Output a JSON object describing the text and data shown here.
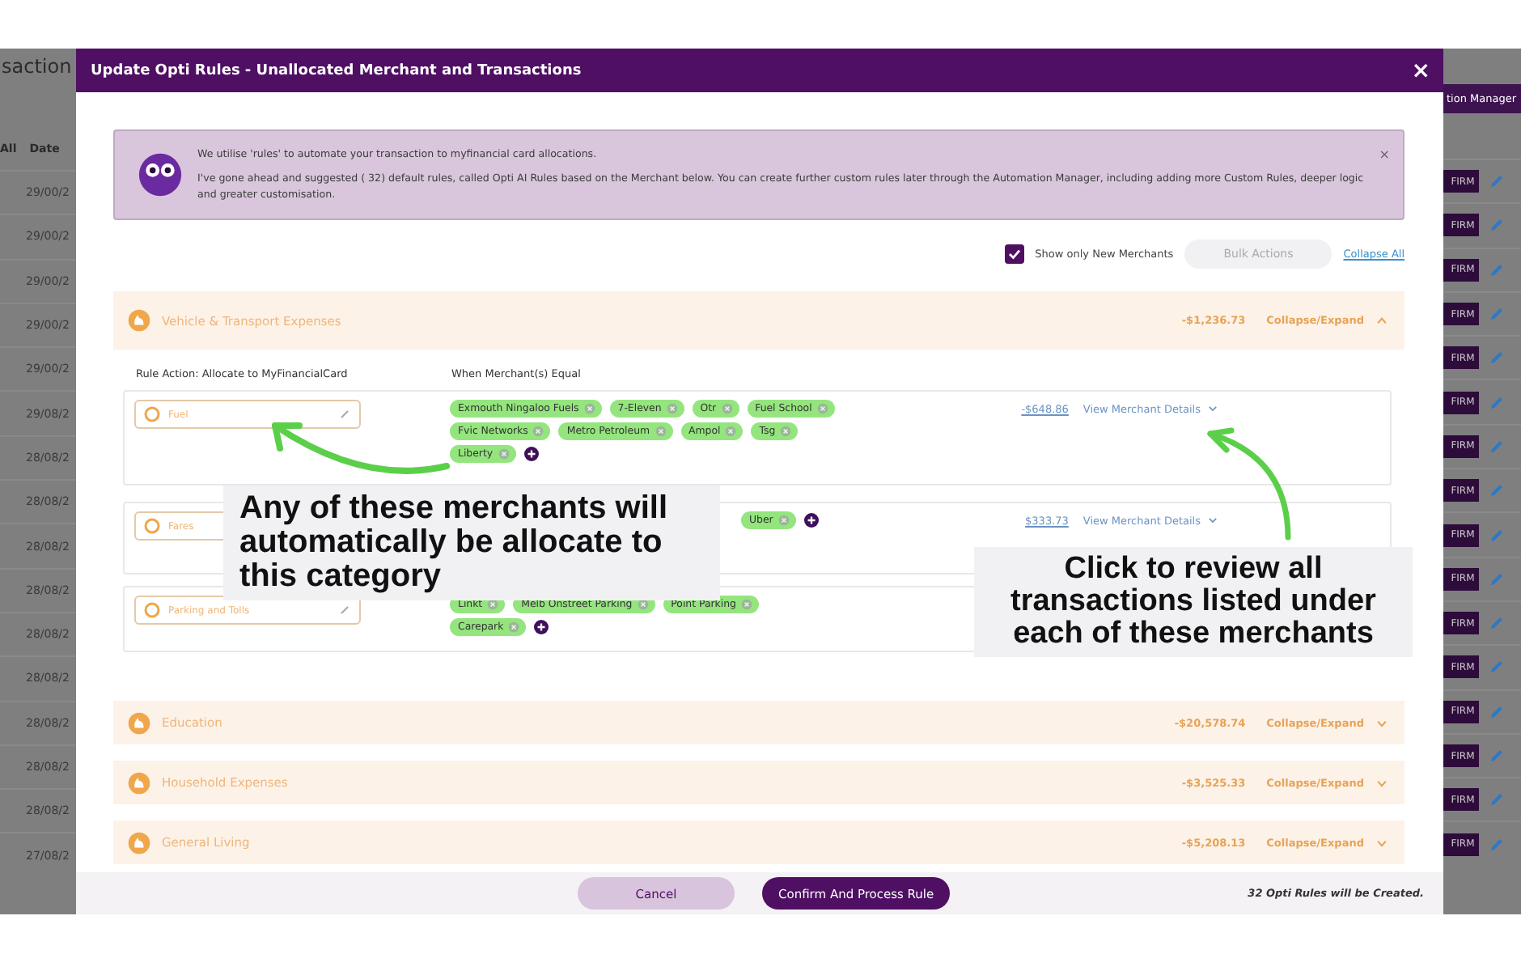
{
  "background": {
    "page_title": "saction",
    "header_all": "All",
    "header_date": "Date",
    "automation_button": "tion Manager",
    "rows": [
      {
        "date": "29/00/2",
        "action": "FIRM"
      },
      {
        "date": "29/00/2",
        "action": "FIRM"
      },
      {
        "date": "29/00/2",
        "action": "FIRM"
      },
      {
        "date": "29/00/2",
        "action": "FIRM"
      },
      {
        "date": "29/00/2",
        "action": "FIRM"
      },
      {
        "date": "29/08/2",
        "action": "FIRM"
      },
      {
        "date": "28/08/2",
        "action": "FIRM"
      },
      {
        "date": "28/08/2",
        "action": "FIRM"
      },
      {
        "date": "28/08/2",
        "action": "FIRM"
      },
      {
        "date": "28/08/2",
        "action": "FIRM"
      },
      {
        "date": "28/08/2",
        "action": "FIRM"
      },
      {
        "date": "28/08/2",
        "action": "FIRM"
      },
      {
        "date": "28/08/2",
        "action": "FIRM"
      },
      {
        "date": "28/08/2",
        "action": "FIRM"
      },
      {
        "date": "28/08/2",
        "action": "FIRM"
      },
      {
        "date": "27/08/2",
        "action": "FIRM"
      }
    ]
  },
  "modal": {
    "title": "Update Opti Rules - Unallocated Merchant and Transactions",
    "close": "×"
  },
  "info": {
    "line1": "We utilise 'rules' to automate your transaction to myfinancial card allocations.",
    "line2": "I've gone ahead and suggested ( 32) default rules, called Opti AI Rules based on the Merchant below. You can create further custom rules later through the Automation Manager, including adding more Custom Rules, deeper logic and greater customisation.",
    "close": "×"
  },
  "filters": {
    "show_new_label": "Show only New Merchants",
    "show_new_checked": true,
    "bulk_actions": "Bulk Actions",
    "collapse_all": "Collapse All"
  },
  "columns": {
    "rule_action": "Rule Action: Allocate to MyFinancialCard",
    "when": "When Merchant(s) Equal"
  },
  "categories": [
    {
      "name": "Vehicle & Transport Expenses",
      "amount": "-$1,236.73",
      "toggle": "Collapse/Expand",
      "expanded": true,
      "rules": [
        {
          "category": "Fuel",
          "merchants": [
            "Exmouth Ningaloo Fuels",
            "7-Eleven",
            "Otr",
            "Fuel School",
            "Fvic Networks",
            "Metro Petroleum",
            "Ampol",
            "Tsg",
            "Liberty"
          ],
          "amount": "-$648.86",
          "details": "View Merchant Details"
        },
        {
          "category": "Fares",
          "merchants": [
            "Uber"
          ],
          "amount": "$333.73",
          "details": "View Merchant Details"
        },
        {
          "category": "Parking and Tolls",
          "merchants": [
            "Linkt",
            "Melb Onstreet Parking",
            "Point Parking",
            "Carepark"
          ]
        }
      ]
    },
    {
      "name": "Education",
      "amount": "-$20,578.74",
      "toggle": "Collapse/Expand",
      "expanded": false
    },
    {
      "name": "Household Expenses",
      "amount": "-$3,525.33",
      "toggle": "Collapse/Expand",
      "expanded": false
    },
    {
      "name": "General Living",
      "amount": "-$5,208.13",
      "toggle": "Collapse/Expand",
      "expanded": false
    }
  ],
  "footer": {
    "cancel": "Cancel",
    "confirm": "Confirm And Process Rule",
    "summary": "32 Opti Rules will be Created."
  },
  "callouts": [
    {
      "text": "Any of these merchants will automatically be allocate to this category"
    },
    {
      "text": "Click to review all transactions listed under each of these merchants"
    }
  ]
}
